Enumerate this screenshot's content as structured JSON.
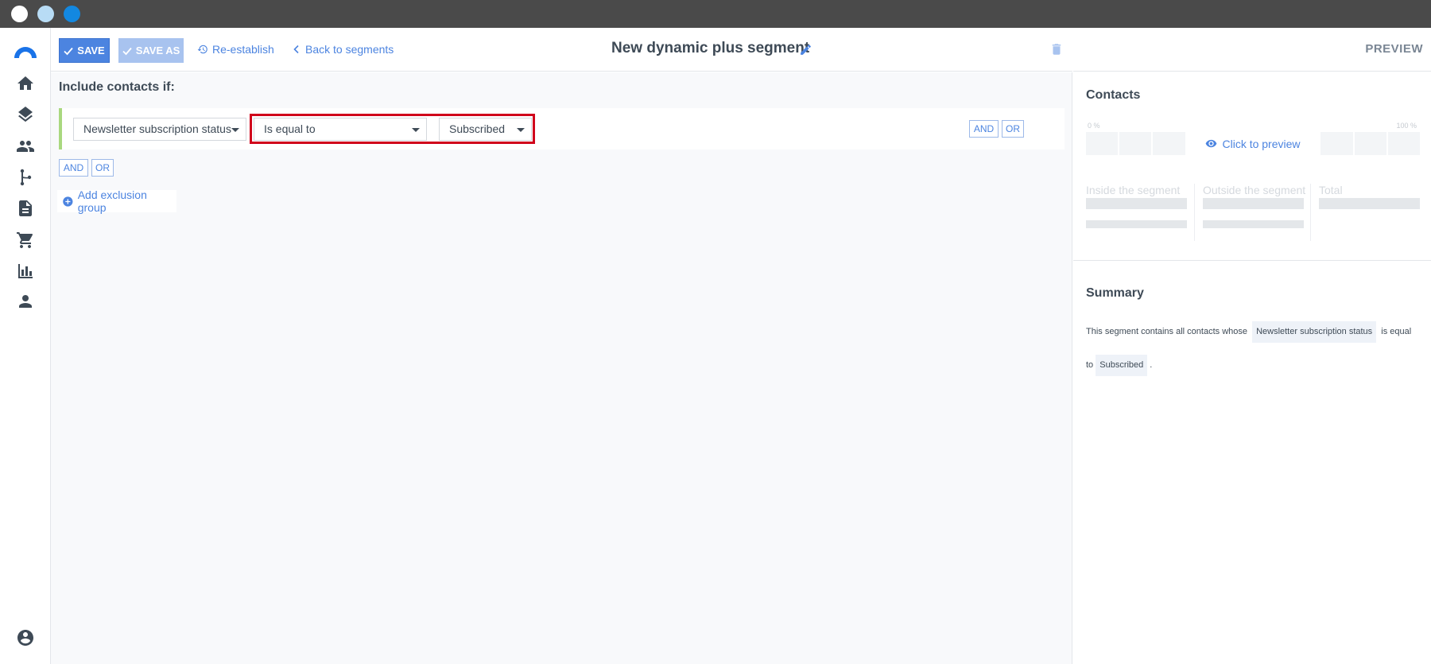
{
  "window": {
    "dots": [
      "close",
      "minimize",
      "maximize"
    ]
  },
  "nav": {
    "items": [
      "home-icon",
      "layers-icon",
      "contacts-icon",
      "automation-icon",
      "document-icon",
      "cart-icon",
      "reports-icon",
      "user-icon",
      "account-icon"
    ]
  },
  "toolbar": {
    "save_label": "SAVE",
    "save_as_label": "SAVE AS",
    "reestablish_label": "Re-establish",
    "back_label": "Back to segments",
    "segment_title": "New dynamic plus segment"
  },
  "builder": {
    "include_label": "Include contacts if:",
    "condition": {
      "field": "Newsletter subscription status",
      "operator": "Is equal to",
      "value": "Subscribed",
      "and_label": "AND",
      "or_label": "OR"
    },
    "group_and_label": "AND",
    "group_or_label": "OR",
    "add_exclusion_label": "Add exclusion group"
  },
  "preview": {
    "title": "PREVIEW",
    "contacts_title": "Contacts",
    "pct_min": "0 %",
    "pct_max": "100 %",
    "click_to_preview": "Click to preview",
    "stats": {
      "inside": "Inside the segment",
      "outside": "Outside the segment",
      "total": "Total"
    },
    "summary_title": "Summary",
    "summary": {
      "prefix": "This segment contains all contacts whose",
      "field": "Newsletter subscription status",
      "middle": "is equal to",
      "value": "Subscribed",
      "suffix": "."
    }
  },
  "colors": {
    "accent": "#4c84e0",
    "highlight": "#d0021b",
    "condition_border": "#a9d87f"
  }
}
